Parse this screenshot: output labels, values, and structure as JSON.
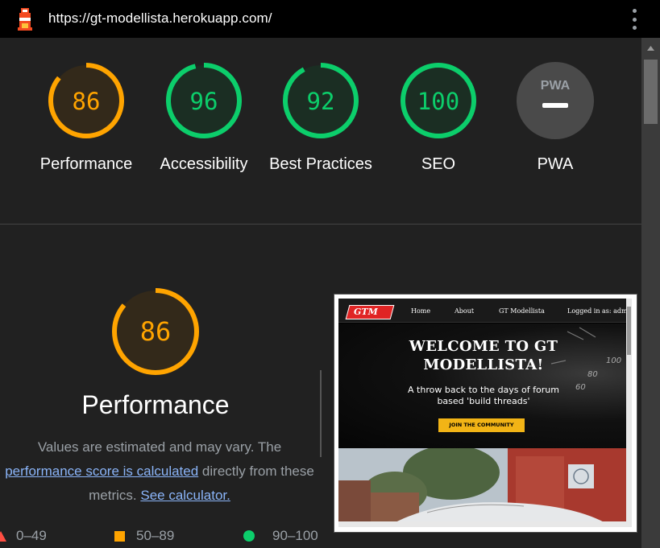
{
  "browser": {
    "url": "https://gt-modellista.herokuapp.com/"
  },
  "colors": {
    "pass": "#0cce6b",
    "average": "#ffa400",
    "fail": "#ff4e42",
    "neutral": "#9aa0a6"
  },
  "gauges": [
    {
      "label": "Performance",
      "score": 86,
      "status": "average"
    },
    {
      "label": "Accessibility",
      "score": 96,
      "status": "pass"
    },
    {
      "label": "Best Practices",
      "score": 92,
      "status": "pass"
    },
    {
      "label": "SEO",
      "score": 100,
      "status": "pass"
    },
    {
      "label": "PWA",
      "score": null,
      "status": "neutral",
      "badge": "PWA"
    }
  ],
  "performance": {
    "score": "86",
    "title": "Performance",
    "desc_prefix": "Values are estimated and may vary. The ",
    "link_calc": "performance score is calculated",
    "desc_mid": " directly from these metrics. ",
    "link_calculator": "See calculator."
  },
  "legend": [
    {
      "range": "0–49",
      "status": "fail"
    },
    {
      "range": "50–89",
      "status": "average"
    },
    {
      "range": "90–100",
      "status": "pass"
    }
  ],
  "screenshot": {
    "logo": "GTM",
    "nav": [
      "Home",
      "About",
      "GT Modellista",
      "Logged in as: admin"
    ],
    "hero_title": "WELCOME TO GT MODELLISTA!",
    "hero_sub": "A throw back to the days of forum based 'build threads'",
    "cta": "JOIN THE COMMUNITY",
    "gauge_numbers": [
      "100",
      "80",
      "60"
    ]
  }
}
